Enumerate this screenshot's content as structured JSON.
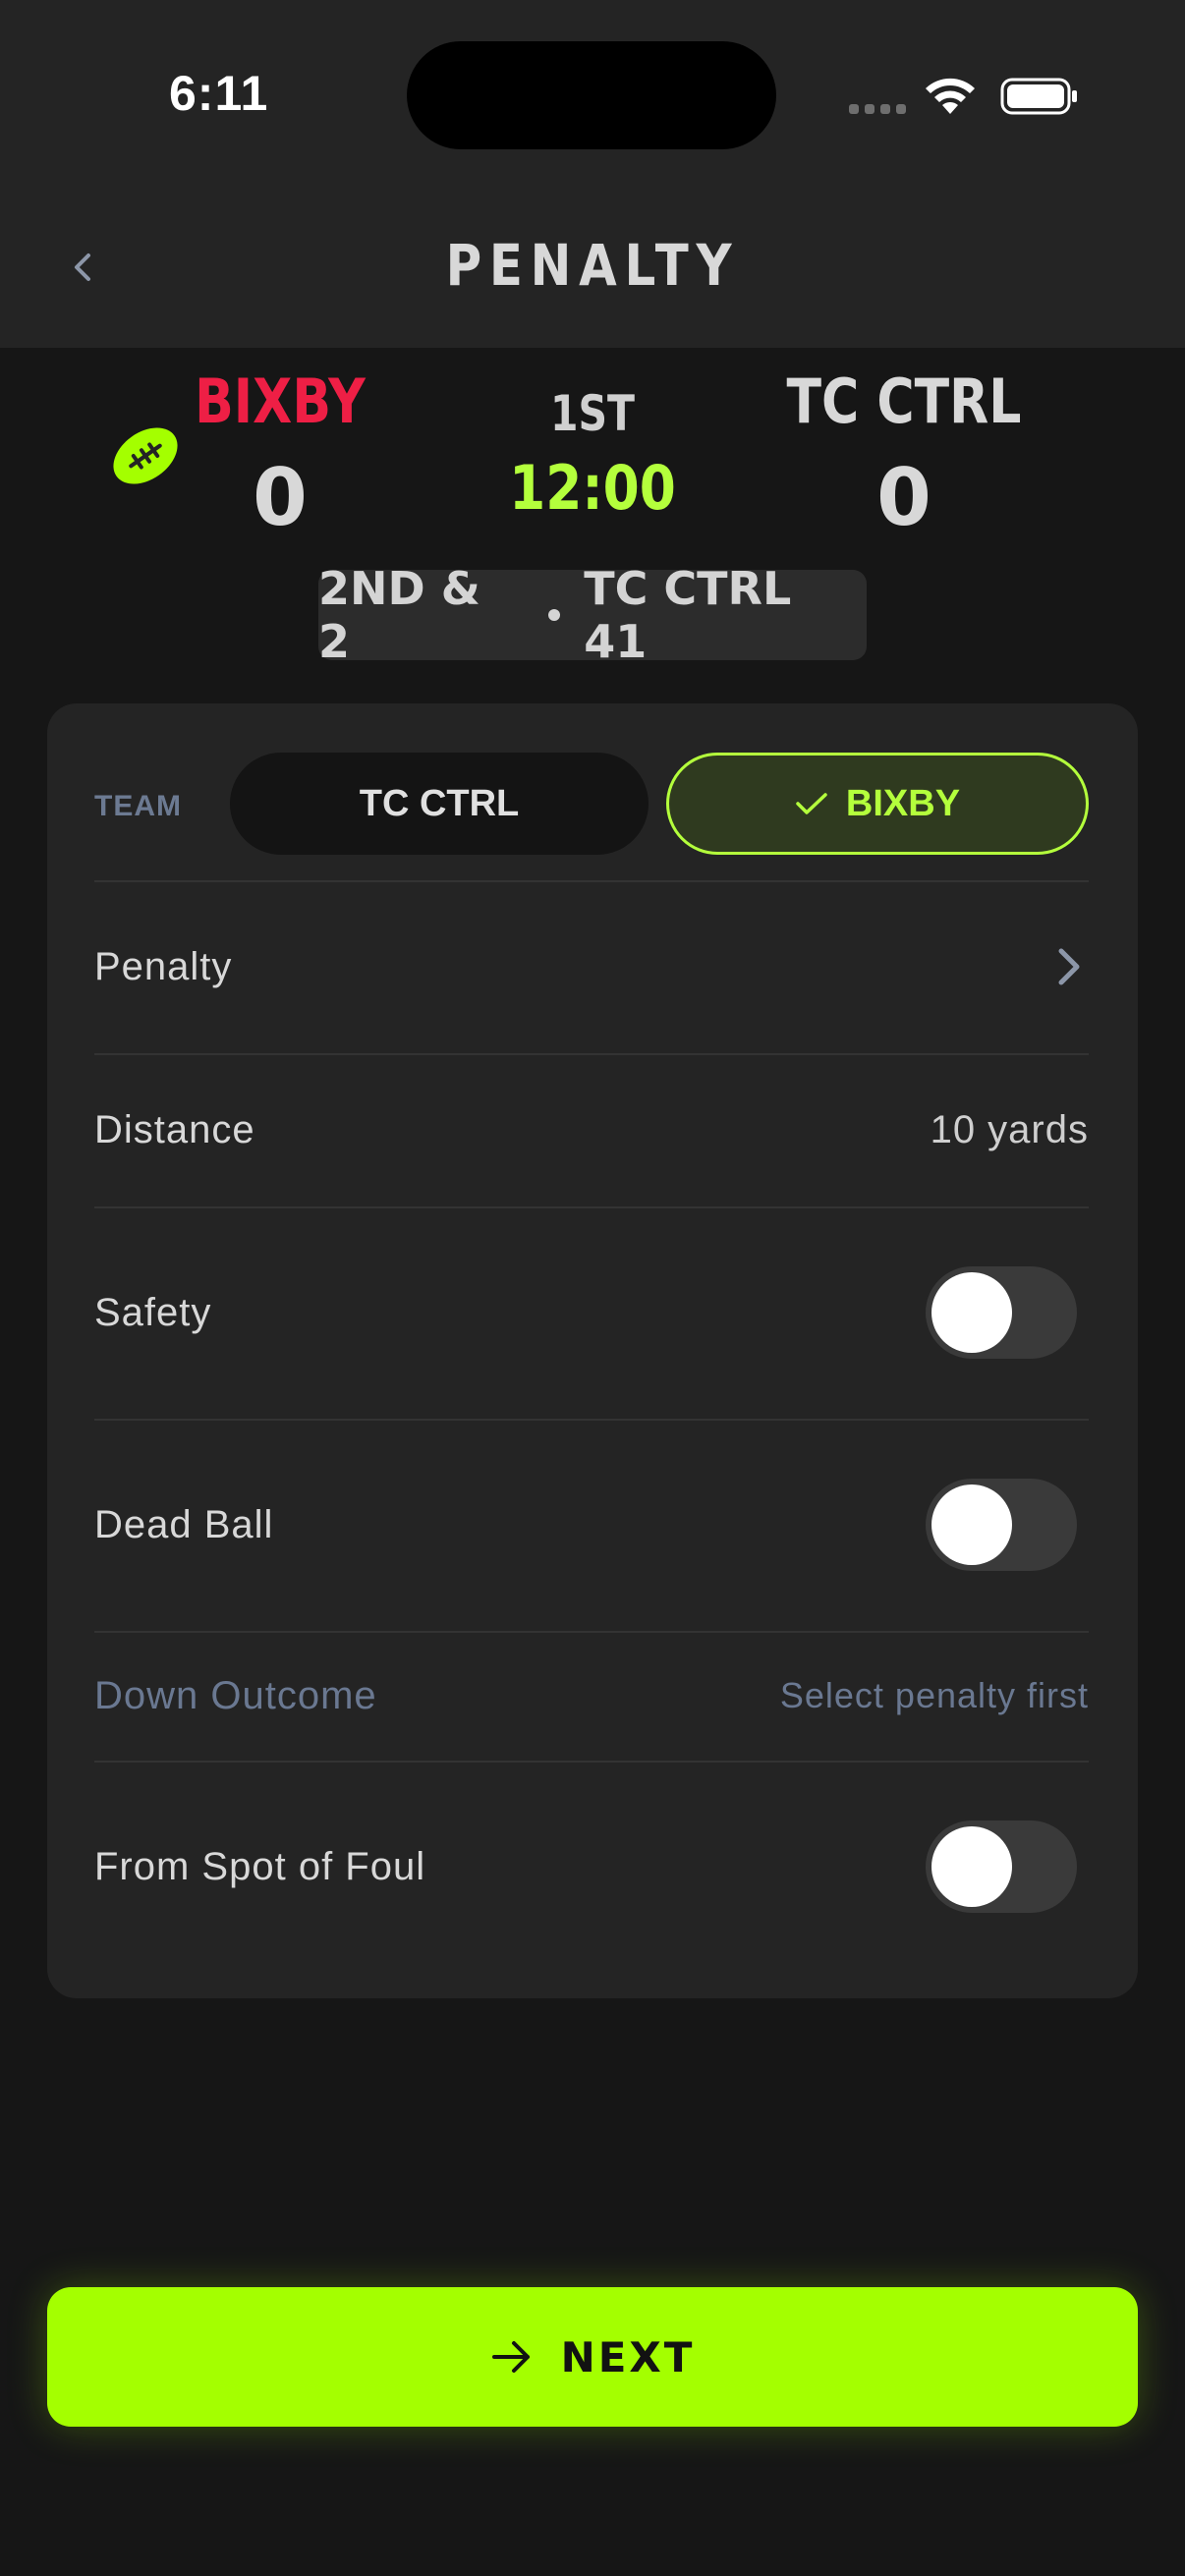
{
  "status_bar": {
    "time": "6:11"
  },
  "header": {
    "title": "PENALTY",
    "back_icon": "chevron-left-icon"
  },
  "scoreboard": {
    "possession_icon": "football-icon",
    "home": {
      "name": "BIXBY",
      "score": "0",
      "color": "#ee1f45"
    },
    "period": "1ST",
    "clock": "12:00",
    "away": {
      "name": "TC CTRL",
      "score": "0"
    },
    "down_distance": "2ND & 2",
    "field_position": "TC CTRL 41"
  },
  "form": {
    "team": {
      "label": "TEAM",
      "options": [
        "TC CTRL",
        "BIXBY"
      ],
      "selected": "BIXBY"
    },
    "penalty": {
      "label": "Penalty"
    },
    "distance": {
      "label": "Distance",
      "value": "10 yards"
    },
    "safety": {
      "label": "Safety",
      "on": false
    },
    "dead_ball": {
      "label": "Dead Ball",
      "on": false
    },
    "down_outcome": {
      "label": "Down Outcome",
      "value": "Select penalty first"
    },
    "from_spot_of_foul": {
      "label": "From Spot of Foul",
      "on": false
    }
  },
  "footer": {
    "next_label": "NEXT",
    "next_icon": "arrow-right-icon"
  },
  "colors": {
    "accent": "#a4ff00",
    "accent_text": "#b4ff3c",
    "home_team": "#ee1f45",
    "muted": "#6a7891"
  }
}
